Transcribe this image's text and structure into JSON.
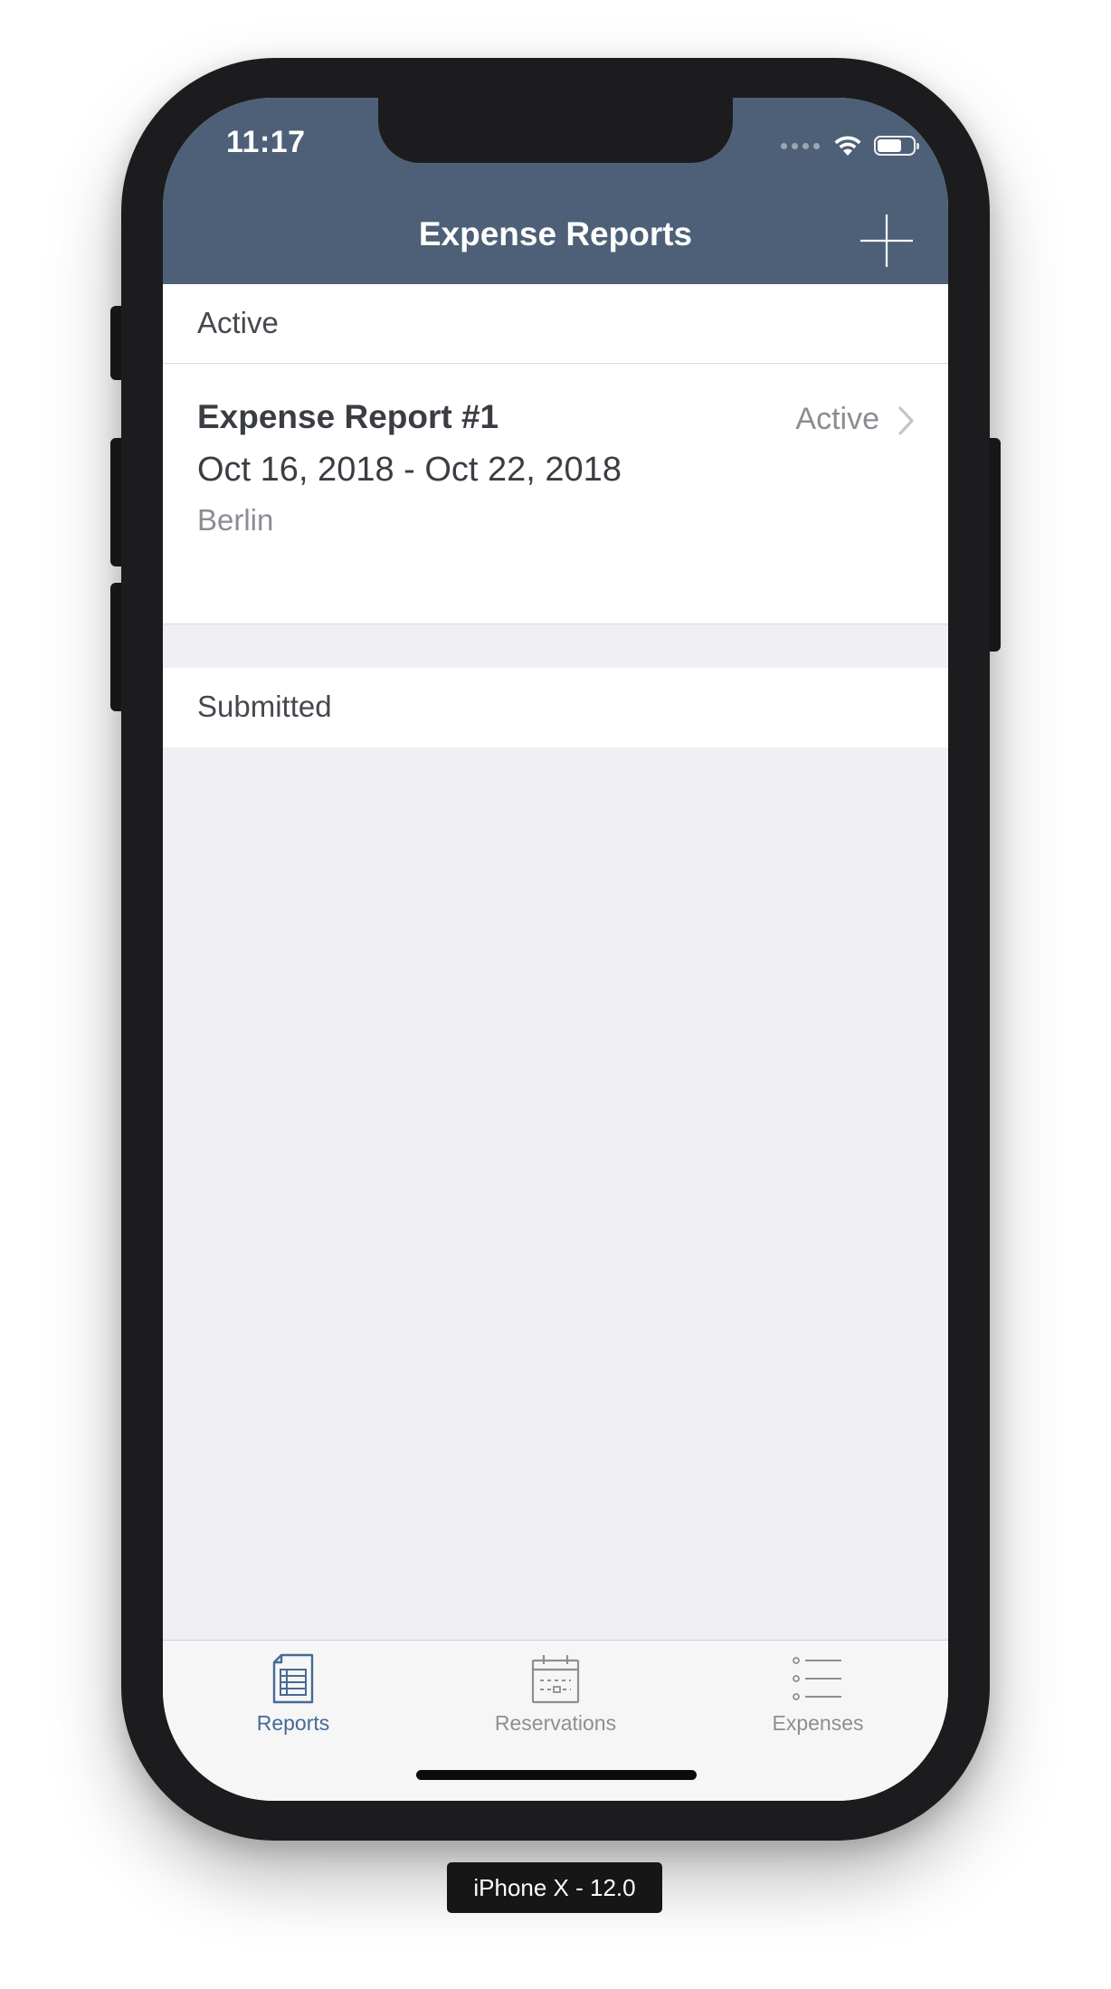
{
  "status_bar": {
    "time": "11:17",
    "icons": [
      "signal-dots-icon",
      "wifi-icon",
      "battery-icon"
    ]
  },
  "nav": {
    "title": "Expense Reports",
    "add_icon": "plus-icon"
  },
  "sections": {
    "active": {
      "header": "Active",
      "reports": [
        {
          "title": "Expense Report #1",
          "dates": "Oct 16, 2018 - Oct 22, 2018",
          "location": "Berlin",
          "status": "Active",
          "accessory_icon": "chevron-right-icon"
        }
      ]
    },
    "submitted": {
      "header": "Submitted"
    }
  },
  "tabbar": {
    "tabs": [
      {
        "label": "Reports",
        "icon": "report-document-icon",
        "selected": true
      },
      {
        "label": "Reservations",
        "icon": "calendar-icon",
        "selected": false
      },
      {
        "label": "Expenses",
        "icon": "list-icon",
        "selected": false
      }
    ]
  },
  "device_label": "iPhone X - 12.0",
  "colors": {
    "nav_background": "#4d6077",
    "tab_active": "#466a94",
    "tab_inactive": "#8e8e93",
    "list_background": "#efeff4"
  }
}
